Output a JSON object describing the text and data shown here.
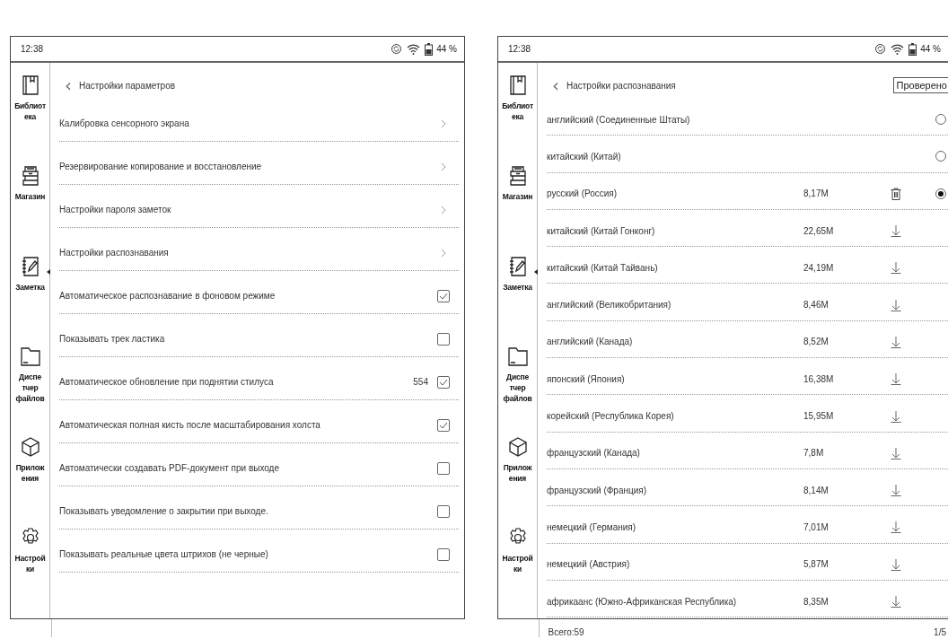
{
  "screens": [
    {
      "status_bar": {
        "time": "12:38",
        "battery": "44 %"
      },
      "sidebar": [
        {
          "label": "Библиот\nека",
          "selected": false
        },
        {
          "label": "Магазин",
          "selected": false
        },
        {
          "label": "Заметка",
          "selected": true
        },
        {
          "label": "Диспе\nтчер\nфайлов",
          "selected": false
        },
        {
          "label": "Прилож\nения",
          "selected": false
        },
        {
          "label": "Настрой\nки",
          "selected": false
        }
      ],
      "header": {
        "back": "‹",
        "title": "Настройки параметров"
      },
      "settings": [
        {
          "kind": "link",
          "label": "Калибровка сенсорного экрана"
        },
        {
          "kind": "link",
          "label": "Резервирование копирование и восстановление"
        },
        {
          "kind": "link",
          "label": "Настройки пароля заметок"
        },
        {
          "kind": "link",
          "label": "Настройки распознавания"
        },
        {
          "kind": "checkbox",
          "label": "Автоматическое распознавание в фоновом режиме",
          "checked": true
        },
        {
          "kind": "checkbox",
          "label": "Показывать трек ластика",
          "checked": false
        },
        {
          "kind": "checkbox",
          "label": "Автоматическое обновление при поднятии стилуса",
          "value": "554",
          "checked": true
        },
        {
          "kind": "checkbox",
          "label": "Автоматическая полная кисть после масштабирования холста",
          "checked": true
        },
        {
          "kind": "checkbox",
          "label": "Автоматически создавать PDF-документ при выходе",
          "checked": false
        },
        {
          "kind": "checkbox",
          "label": "Показывать уведомление о закрытии при выходе.",
          "checked": false
        },
        {
          "kind": "checkbox",
          "label": "Показывать реальные цвета штрихов (не черные)",
          "checked": false
        }
      ]
    },
    {
      "status_bar": {
        "time": "12:38",
        "battery": "44 %"
      },
      "sidebar": [
        {
          "label": "Библиот\nека",
          "selected": false
        },
        {
          "label": "Магазин",
          "selected": false
        },
        {
          "label": "Заметка",
          "selected": true
        },
        {
          "label": "Диспе\nтчер\nфайлов",
          "selected": false
        },
        {
          "label": "Прилож\nения",
          "selected": false
        },
        {
          "label": "Настрой\nки",
          "selected": false
        }
      ],
      "header": {
        "back": "‹",
        "title": "Настройки распознавания",
        "button": "Проверено"
      },
      "languages": [
        {
          "name": "английский (Соединенные Штаты)",
          "kind": "plain",
          "selected": false
        },
        {
          "name": "китайский (Китай)",
          "kind": "plain",
          "selected": false
        },
        {
          "name": "русский (Россия)",
          "size": "8,17M",
          "kind": "delete",
          "selected": true
        },
        {
          "name": "китайский (Китай Гонконг)",
          "size": "22,65M",
          "kind": "download"
        },
        {
          "name": "китайский (Китай Тайвань)",
          "size": "24,19M",
          "kind": "download"
        },
        {
          "name": "английский (Великобритания)",
          "size": "8,46M",
          "kind": "download"
        },
        {
          "name": "английский (Канада)",
          "size": "8,52M",
          "kind": "download"
        },
        {
          "name": "японский (Япония)",
          "size": "16,38M",
          "kind": "download"
        },
        {
          "name": "корейский (Республика Корея)",
          "size": "15,95M",
          "kind": "download"
        },
        {
          "name": "французский (Канада)",
          "size": "7,8M",
          "kind": "download"
        },
        {
          "name": "французский (Франция)",
          "size": "8,14M",
          "kind": "download"
        },
        {
          "name": "немецкий (Германия)",
          "size": "7,01M",
          "kind": "download"
        },
        {
          "name": "немецкий (Австрия)",
          "size": "5,87M",
          "kind": "download"
        },
        {
          "name": "африкаанс (Южно-Африканская Республика)",
          "size": "8,35M",
          "kind": "download"
        }
      ],
      "footer": {
        "total": "Всего:59",
        "page": "1/5"
      }
    }
  ]
}
